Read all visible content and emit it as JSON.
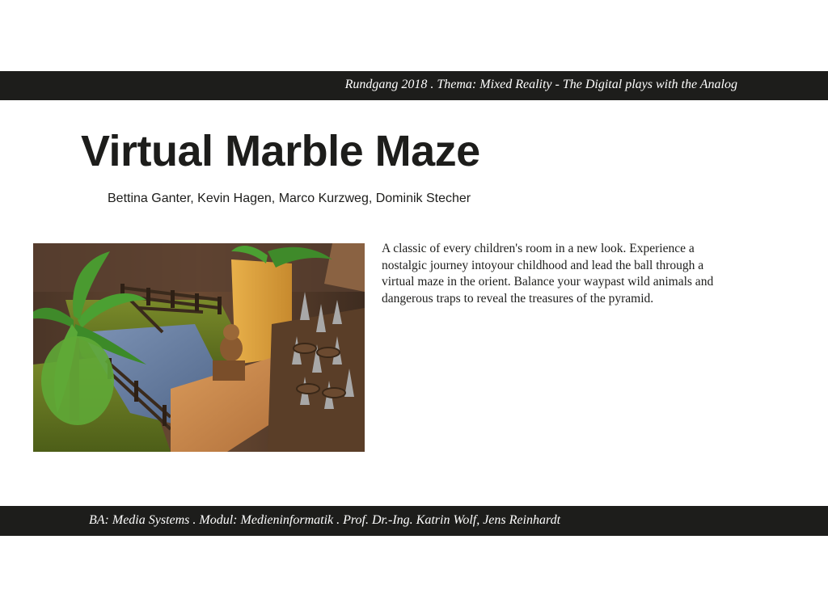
{
  "header": {
    "banner_text": "Rundgang 2018 . Thema: Mixed Reality - The Digital plays with the Analog"
  },
  "project": {
    "title": "Virtual Marble Maze",
    "authors": "Bettina Ganter, Kevin Hagen, Marco Kurzweg, Dominik Stecher",
    "description": "A classic of every children's room in a new look. Experience a nostalgic journey intoyour childhood and lead the ball through a virtual maze in the orient. Balance your waypast wild animals and dangerous traps to reveal the treasures of the pyramid."
  },
  "footer": {
    "credits_text": "BA: Media Systems . Modul: Medieninformatik . Prof. Dr.-Ing. Katrin Wolf, Jens Reinhardt"
  },
  "colors": {
    "bar_background": "#1d1d1b",
    "bar_text": "#ffffff",
    "text": "#1d1d1b"
  }
}
